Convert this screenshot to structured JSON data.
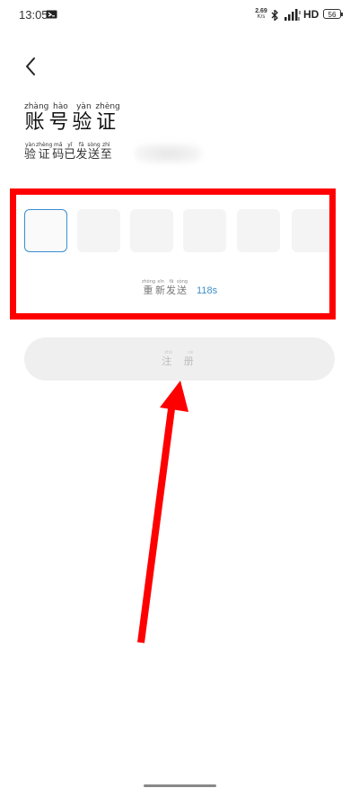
{
  "status_bar": {
    "time": "13:05",
    "net_speed": "2.69",
    "net_unit": "K/s",
    "network_type": "HD",
    "battery": "56",
    "icons": [
      "notification-icon",
      "bluetooth-icon",
      "signal-icon",
      "battery-icon"
    ]
  },
  "nav": {
    "back_icon": "chevron-left-icon"
  },
  "title": {
    "chars": [
      {
        "hanzi": "账",
        "pinyin": "zhàng"
      },
      {
        "hanzi": "号",
        "pinyin": "hào"
      },
      {
        "hanzi": "验",
        "pinyin": "yàn"
      },
      {
        "hanzi": "证",
        "pinyin": "zhèng"
      }
    ]
  },
  "subtitle": {
    "chars": [
      {
        "hanzi": "验",
        "pinyin": "yàn"
      },
      {
        "hanzi": "证",
        "pinyin": "zhèng"
      },
      {
        "hanzi": "码",
        "pinyin": "mǎ"
      },
      {
        "hanzi": "已",
        "pinyin": "yǐ"
      },
      {
        "hanzi": "发",
        "pinyin": "fā"
      },
      {
        "hanzi": "送",
        "pinyin": "sòng"
      },
      {
        "hanzi": "至",
        "pinyin": "zhì"
      }
    ]
  },
  "code_input": {
    "boxes": 6,
    "active_index": 0
  },
  "resend": {
    "chars": [
      {
        "hanzi": "重",
        "pinyin": "zhòng"
      },
      {
        "hanzi": "新",
        "pinyin": "xīn"
      },
      {
        "hanzi": "发",
        "pinyin": "fā"
      },
      {
        "hanzi": "送",
        "pinyin": "sòng"
      }
    ],
    "countdown": "118s"
  },
  "register_button": {
    "chars": [
      {
        "hanzi": "注",
        "pinyin": "zhù"
      },
      {
        "hanzi": "册",
        "pinyin": "cè"
      }
    ],
    "enabled": false
  },
  "colors": {
    "highlight": "#ff0000",
    "accent": "#3d8fc7",
    "active_box_border": "#3a8fd1",
    "button_bg": "#efefef"
  }
}
